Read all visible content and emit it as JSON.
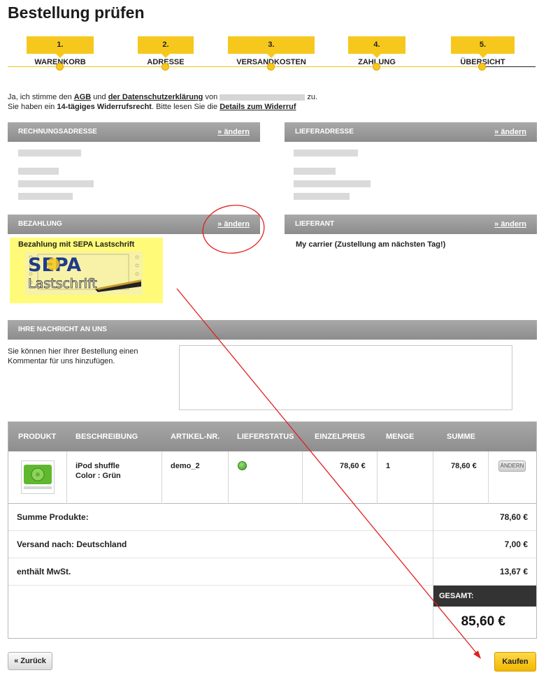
{
  "page": {
    "title": "Bestellung prüfen"
  },
  "steps": [
    {
      "label": "1. WARENKORB"
    },
    {
      "label": "2. ADRESSE"
    },
    {
      "label": "3. VERSANDKOSTEN"
    },
    {
      "label": "4. ZAHLUNG"
    },
    {
      "label": "5. ÜBERSICHT"
    }
  ],
  "agb": {
    "line1_prefix": "Ja, ich stimme den",
    "agb_link": "AGB",
    "and": "und",
    "privacy_link": "der Datenschutzerklärung",
    "from": "von",
    "suffix": "zu.",
    "line2_prefix": "Sie haben ein",
    "line2_bold": "14-tägiges Widerrufsrecht",
    "line2_mid": ". Bitte lesen Sie die",
    "details_link": "Details zum Widerruf"
  },
  "sections": {
    "billing": {
      "title": "RECHNUNGSADRESSE",
      "change": "» ändern"
    },
    "shipping": {
      "title": "LIEFERADRESSE",
      "change": "» ändern"
    },
    "payment": {
      "title": "BEZAHLUNG",
      "change": "» ändern",
      "method": "Bezahlung mit SEPA Lastschrift",
      "logo_main": "SEPA",
      "logo_sub": "Lastschrift"
    },
    "carrier": {
      "title": "LIEFERANT",
      "change": "» ändern",
      "name": "My carrier (Zustellung am nächsten Tag!)"
    },
    "message": {
      "title": "IHRE NACHRICHT AN UNS",
      "text": "Sie können hier Ihrer Bestellung einen Kommentar für uns hinzufügen.",
      "value": ""
    }
  },
  "cart": {
    "headers": [
      "PRODUKT",
      "BESCHREIBUNG",
      "ARTIKEL-NR.",
      "LIEFERSTATUS",
      "EINZELPREIS",
      "MENGE",
      "SUMME"
    ],
    "items": [
      {
        "name": "iPod shuffle",
        "variant": "Color : Grün",
        "sku": "demo_2",
        "price": "78,60 €",
        "qty": "1",
        "total": "78,60 €",
        "change": "ÄNDERN"
      }
    ],
    "summary": [
      {
        "label": "Summe Produkte:",
        "value": "78,60 €"
      },
      {
        "label": "Versand nach: Deutschland",
        "value": "7,00 €"
      },
      {
        "label": "enthält MwSt.",
        "value": "13,67 €"
      }
    ],
    "total_label": "GESAMT:",
    "total_value": "85,60 €"
  },
  "buttons": {
    "back": "« Zurück",
    "buy": "Kaufen"
  },
  "colors": {
    "accent": "#f6c81e",
    "annotation": "#e02020"
  }
}
